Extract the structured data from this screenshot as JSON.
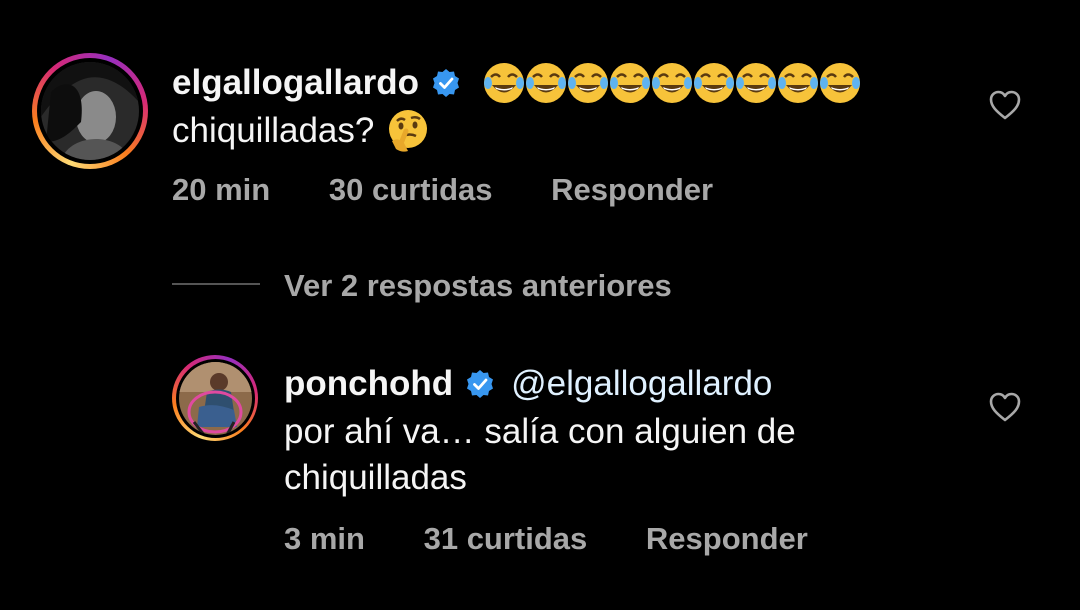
{
  "comment": {
    "username": "elgallogallardo",
    "verified": true,
    "emoji_prefix": "face-with-tears-of-joy x9",
    "text": "chiquilladas?",
    "text_emoji": "thinking-face",
    "time": "20 min",
    "likes": "30 curtidas",
    "reply": "Responder"
  },
  "view_previous": "Ver 2 respostas anteriores",
  "reply": {
    "username": "ponchohd",
    "verified": true,
    "mention": "@elgallogallardo",
    "line1": "por ahí va… salía con alguien de",
    "line2": "chiquilladas",
    "time": "3 min",
    "likes": "31 curtidas",
    "reply": "Responder"
  },
  "colors": {
    "background": "#000000",
    "text": "#f5f5f5",
    "meta": "#a8a8a8",
    "verified": "#3897f0"
  }
}
